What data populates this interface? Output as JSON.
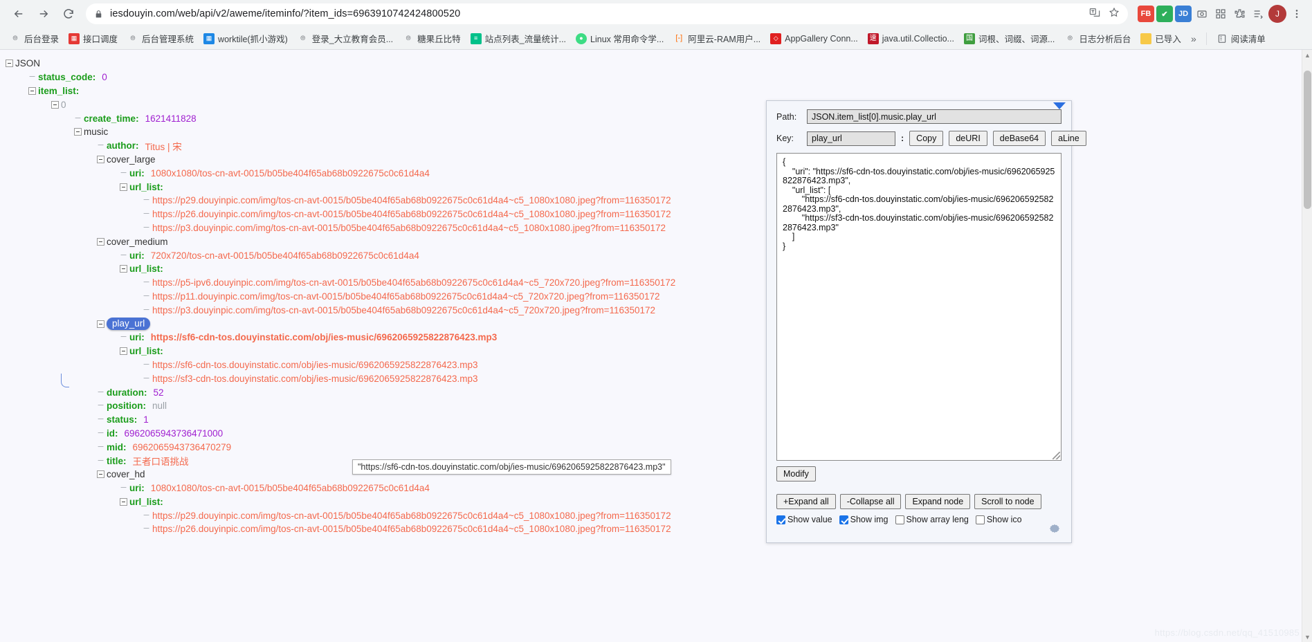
{
  "browser": {
    "url": "iesdouyin.com/web/api/v2/aweme/iteminfo/?item_ids=6963910742424800520",
    "back_icon": "back-arrow-icon",
    "forward_icon": "forward-arrow-icon",
    "reload_icon": "reload-icon",
    "lock_icon": "lock-icon",
    "translate_icon": "translate-icon",
    "bookmark_star_icon": "star-icon",
    "avatar_label": "J",
    "extensions": [
      {
        "name": "fb-extension",
        "label": "FB",
        "color": "#e8483c"
      },
      {
        "name": "shield-extension",
        "label": "✔",
        "color": "#2eaf5b"
      },
      {
        "name": "jd-extension",
        "label": "JD",
        "color": "#3a7fd5"
      },
      {
        "name": "camera-extension",
        "label": "▣",
        "color": "#5f6368"
      },
      {
        "name": "grid-extension",
        "label": "▦",
        "color": "#5f6368"
      },
      {
        "name": "puzzle-extension",
        "label": "❖",
        "color": "#5f6368"
      },
      {
        "name": "list-extension",
        "label": "☰",
        "color": "#5f6368"
      }
    ]
  },
  "bookmarks": {
    "items": [
      {
        "label": "后台登录",
        "icon": "globe-icon",
        "color": "#5f6368",
        "glyph": "⊕"
      },
      {
        "label": "接口调度",
        "icon": "favicon-red",
        "color": "#e53935",
        "glyph": "▦"
      },
      {
        "label": "后台管理系统",
        "icon": "globe-icon",
        "color": "#5f6368",
        "glyph": "⊕"
      },
      {
        "label": "worktile(抓小游戏)",
        "icon": "favicon-blue",
        "color": "#1e88e5",
        "glyph": "▦"
      },
      {
        "label": "登录_大立教育会员...",
        "icon": "globe-icon",
        "color": "#5f6368",
        "glyph": "⊕"
      },
      {
        "label": "糖果丘比特",
        "icon": "globe-icon",
        "color": "#5f6368",
        "glyph": "⊕"
      },
      {
        "label": "站点列表_流量统计...",
        "icon": "favicon-green",
        "color": "#00c18a",
        "glyph": "≡"
      },
      {
        "label": "Linux 常用命令学...",
        "icon": "favicon-android",
        "color": "#3ddc84",
        "glyph": "●"
      },
      {
        "label": "阿里云-RAM用户...",
        "icon": "favicon-orange",
        "color": "#ff6a00",
        "glyph": "[·]"
      },
      {
        "label": "AppGallery Conn...",
        "icon": "favicon-huawei",
        "color": "#e02020",
        "glyph": "◇"
      },
      {
        "label": "java.util.Collectio...",
        "icon": "favicon-su",
        "color": "#c0182a",
        "glyph": "速"
      },
      {
        "label": "词根、词缀、词源...",
        "icon": "favicon-book",
        "color": "#3f9e3f",
        "glyph": "囗"
      },
      {
        "label": "日志分析后台",
        "icon": "globe-icon",
        "color": "#5f6368",
        "glyph": "⊕"
      },
      {
        "label": "已导入",
        "icon": "folder-icon",
        "color": "#f7c948",
        "glyph": ""
      }
    ],
    "overflow_label": "»",
    "reading_list_label": "阅读清单",
    "reading_list_icon": "reading-list-icon"
  },
  "tree": {
    "root_label": "JSON",
    "rows": [
      {
        "depth": 0,
        "toggle": "minus",
        "key": "JSON",
        "key_style": "plain",
        "value": "",
        "value_style": "none"
      },
      {
        "depth": 1,
        "toggle": "leaf",
        "key": "status_code",
        "key_style": "green",
        "value": "0",
        "value_style": "num"
      },
      {
        "depth": 1,
        "toggle": "minus",
        "key": "item_list",
        "key_style": "green",
        "value": "",
        "value_style": "none"
      },
      {
        "depth": 2,
        "toggle": "minus",
        "key": "0",
        "key_style": "index",
        "value": "",
        "value_style": "none"
      },
      {
        "depth": 3,
        "toggle": "leaf",
        "key": "create_time",
        "key_style": "green",
        "value": "1621411828",
        "value_style": "num"
      },
      {
        "depth": 3,
        "toggle": "minus",
        "key": "music",
        "key_style": "plain",
        "value": "",
        "value_style": "none"
      },
      {
        "depth": 4,
        "toggle": "leaf",
        "key": "author",
        "key_style": "green",
        "value": "Titus | 宋",
        "value_style": "str"
      },
      {
        "depth": 4,
        "toggle": "minus",
        "key": "cover_large",
        "key_style": "plain",
        "value": "",
        "value_style": "none"
      },
      {
        "depth": 5,
        "toggle": "leaf",
        "key": "uri",
        "key_style": "green",
        "value": "1080x1080/tos-cn-avt-0015/b05be404f65ab68b0922675c0c61d4a4",
        "value_style": "str"
      },
      {
        "depth": 5,
        "toggle": "minus",
        "key": "url_list",
        "key_style": "green",
        "value": "",
        "value_style": "none"
      },
      {
        "depth": 6,
        "toggle": "leaf",
        "key": "",
        "key_style": "none",
        "value": "https://p29.douyinpic.com/img/tos-cn-avt-0015/b05be404f65ab68b0922675c0c61d4a4~c5_1080x1080.jpeg?from=116350172",
        "value_style": "link"
      },
      {
        "depth": 6,
        "toggle": "leaf",
        "key": "",
        "key_style": "none",
        "value": "https://p26.douyinpic.com/img/tos-cn-avt-0015/b05be404f65ab68b0922675c0c61d4a4~c5_1080x1080.jpeg?from=116350172",
        "value_style": "link"
      },
      {
        "depth": 6,
        "toggle": "leaf",
        "key": "",
        "key_style": "none",
        "value": "https://p3.douyinpic.com/img/tos-cn-avt-0015/b05be404f65ab68b0922675c0c61d4a4~c5_1080x1080.jpeg?from=116350172",
        "value_style": "link"
      },
      {
        "depth": 4,
        "toggle": "minus",
        "key": "cover_medium",
        "key_style": "plain",
        "value": "",
        "value_style": "none"
      },
      {
        "depth": 5,
        "toggle": "leaf",
        "key": "uri",
        "key_style": "green",
        "value": "720x720/tos-cn-avt-0015/b05be404f65ab68b0922675c0c61d4a4",
        "value_style": "str"
      },
      {
        "depth": 5,
        "toggle": "minus",
        "key": "url_list",
        "key_style": "green",
        "value": "",
        "value_style": "none"
      },
      {
        "depth": 6,
        "toggle": "leaf",
        "key": "",
        "key_style": "none",
        "value": "https://p5-ipv6.douyinpic.com/img/tos-cn-avt-0015/b05be404f65ab68b0922675c0c61d4a4~c5_720x720.jpeg?from=116350172",
        "value_style": "link"
      },
      {
        "depth": 6,
        "toggle": "leaf",
        "key": "",
        "key_style": "none",
        "value": "https://p11.douyinpic.com/img/tos-cn-avt-0015/b05be404f65ab68b0922675c0c61d4a4~c5_720x720.jpeg?from=116350172",
        "value_style": "link"
      },
      {
        "depth": 6,
        "toggle": "leaf",
        "key": "",
        "key_style": "none",
        "value": "https://p3.douyinpic.com/img/tos-cn-avt-0015/b05be404f65ab68b0922675c0c61d4a4~c5_720x720.jpeg?from=116350172",
        "value_style": "link"
      },
      {
        "depth": 4,
        "toggle": "minus",
        "key": "play_url",
        "key_style": "selected",
        "value": "",
        "value_style": "none"
      },
      {
        "depth": 5,
        "toggle": "leaf",
        "key": "uri",
        "key_style": "green",
        "value": "https://sf6-cdn-tos.douyinstatic.com/obj/ies-music/6962065925822876423.mp3",
        "value_style": "strbold"
      },
      {
        "depth": 5,
        "toggle": "minus",
        "key": "url_list",
        "key_style": "green",
        "value": "",
        "value_style": "none"
      },
      {
        "depth": 6,
        "toggle": "leaf",
        "key": "",
        "key_style": "none",
        "value": "https://sf6-cdn-tos.douyinstatic.com/obj/ies-music/6962065925822876423.mp3",
        "value_style": "link"
      },
      {
        "depth": 6,
        "toggle": "leaf",
        "key": "",
        "key_style": "none",
        "value": "https://sf3-cdn-tos.douyinstatic.com/obj/ies-music/6962065925822876423.mp3",
        "value_style": "link"
      },
      {
        "depth": 4,
        "toggle": "leaf",
        "key": "duration",
        "key_style": "green",
        "value": "52",
        "value_style": "num"
      },
      {
        "depth": 4,
        "toggle": "leaf",
        "key": "position",
        "key_style": "green",
        "value": "null",
        "value_style": "null"
      },
      {
        "depth": 4,
        "toggle": "leaf",
        "key": "status",
        "key_style": "green",
        "value": "1",
        "value_style": "num"
      },
      {
        "depth": 4,
        "toggle": "leaf",
        "key": "id",
        "key_style": "green",
        "value": "6962065943736471000",
        "value_style": "num"
      },
      {
        "depth": 4,
        "toggle": "leaf",
        "key": "mid",
        "key_style": "green",
        "value": "6962065943736470279",
        "value_style": "str"
      },
      {
        "depth": 4,
        "toggle": "leaf",
        "key": "title",
        "key_style": "green",
        "value": "王者口语挑战",
        "value_style": "str"
      },
      {
        "depth": 4,
        "toggle": "minus",
        "key": "cover_hd",
        "key_style": "plain",
        "value": "",
        "value_style": "none"
      },
      {
        "depth": 5,
        "toggle": "leaf",
        "key": "uri",
        "key_style": "green",
        "value": "1080x1080/tos-cn-avt-0015/b05be404f65ab68b0922675c0c61d4a4",
        "value_style": "str"
      },
      {
        "depth": 5,
        "toggle": "minus",
        "key": "url_list",
        "key_style": "green",
        "value": "",
        "value_style": "none"
      },
      {
        "depth": 6,
        "toggle": "leaf",
        "key": "",
        "key_style": "none",
        "value": "https://p29.douyinpic.com/img/tos-cn-avt-0015/b05be404f65ab68b0922675c0c61d4a4~c5_1080x1080.jpeg?from=116350172",
        "value_style": "link"
      },
      {
        "depth": 6,
        "toggle": "leaf",
        "key": "",
        "key_style": "none",
        "value": "https://p26.douyinpic.com/img/tos-cn-avt-0015/b05be404f65ab68b0922675c0c61d4a4~c5_1080x1080.jpeg?from=116350172",
        "value_style": "link"
      }
    ],
    "tooltip": "\"https://sf6-cdn-tos.douyinstatic.com/obj/ies-music/6962065925822876423.mp3\""
  },
  "panel": {
    "path_label": "Path:",
    "path_value": "JSON.item_list[0].music.play_url",
    "key_label": "Key:",
    "key_value": "play_url",
    "key_colon": ":",
    "buttons_row1": [
      "Copy",
      "deURI",
      "deBase64",
      "aLine"
    ],
    "editor_value": "{\n    \"uri\": \"https://sf6-cdn-tos.douyinstatic.com/obj/ies-music/6962065925822876423.mp3\",\n    \"url_list\": [\n        \"https://sf6-cdn-tos.douyinstatic.com/obj/ies-music/6962065925822876423.mp3\",\n        \"https://sf3-cdn-tos.douyinstatic.com/obj/ies-music/6962065925822876423.mp3\"\n    ]\n}",
    "modify_label": "Modify",
    "buttons_row2": [
      "+Expand all",
      "-Collapse all",
      "Expand node",
      "Scroll to node"
    ],
    "checkboxes": [
      {
        "label": "Show value",
        "checked": true
      },
      {
        "label": "Show img",
        "checked": true
      },
      {
        "label": "Show array leng",
        "checked": false
      },
      {
        "label": "Show ico",
        "checked": false
      }
    ],
    "gear_icon": "gear-icon"
  },
  "watermark": "https://blog.csdn.net/qq_41510985",
  "colors": {
    "key_green": "#1a9c1a",
    "value_string": "#f4694d",
    "value_number": "#a020d0",
    "selected_bg": "#4a72d4",
    "chrome_bg": "#f1f3f4",
    "page_bg": "#f8f8fd"
  }
}
